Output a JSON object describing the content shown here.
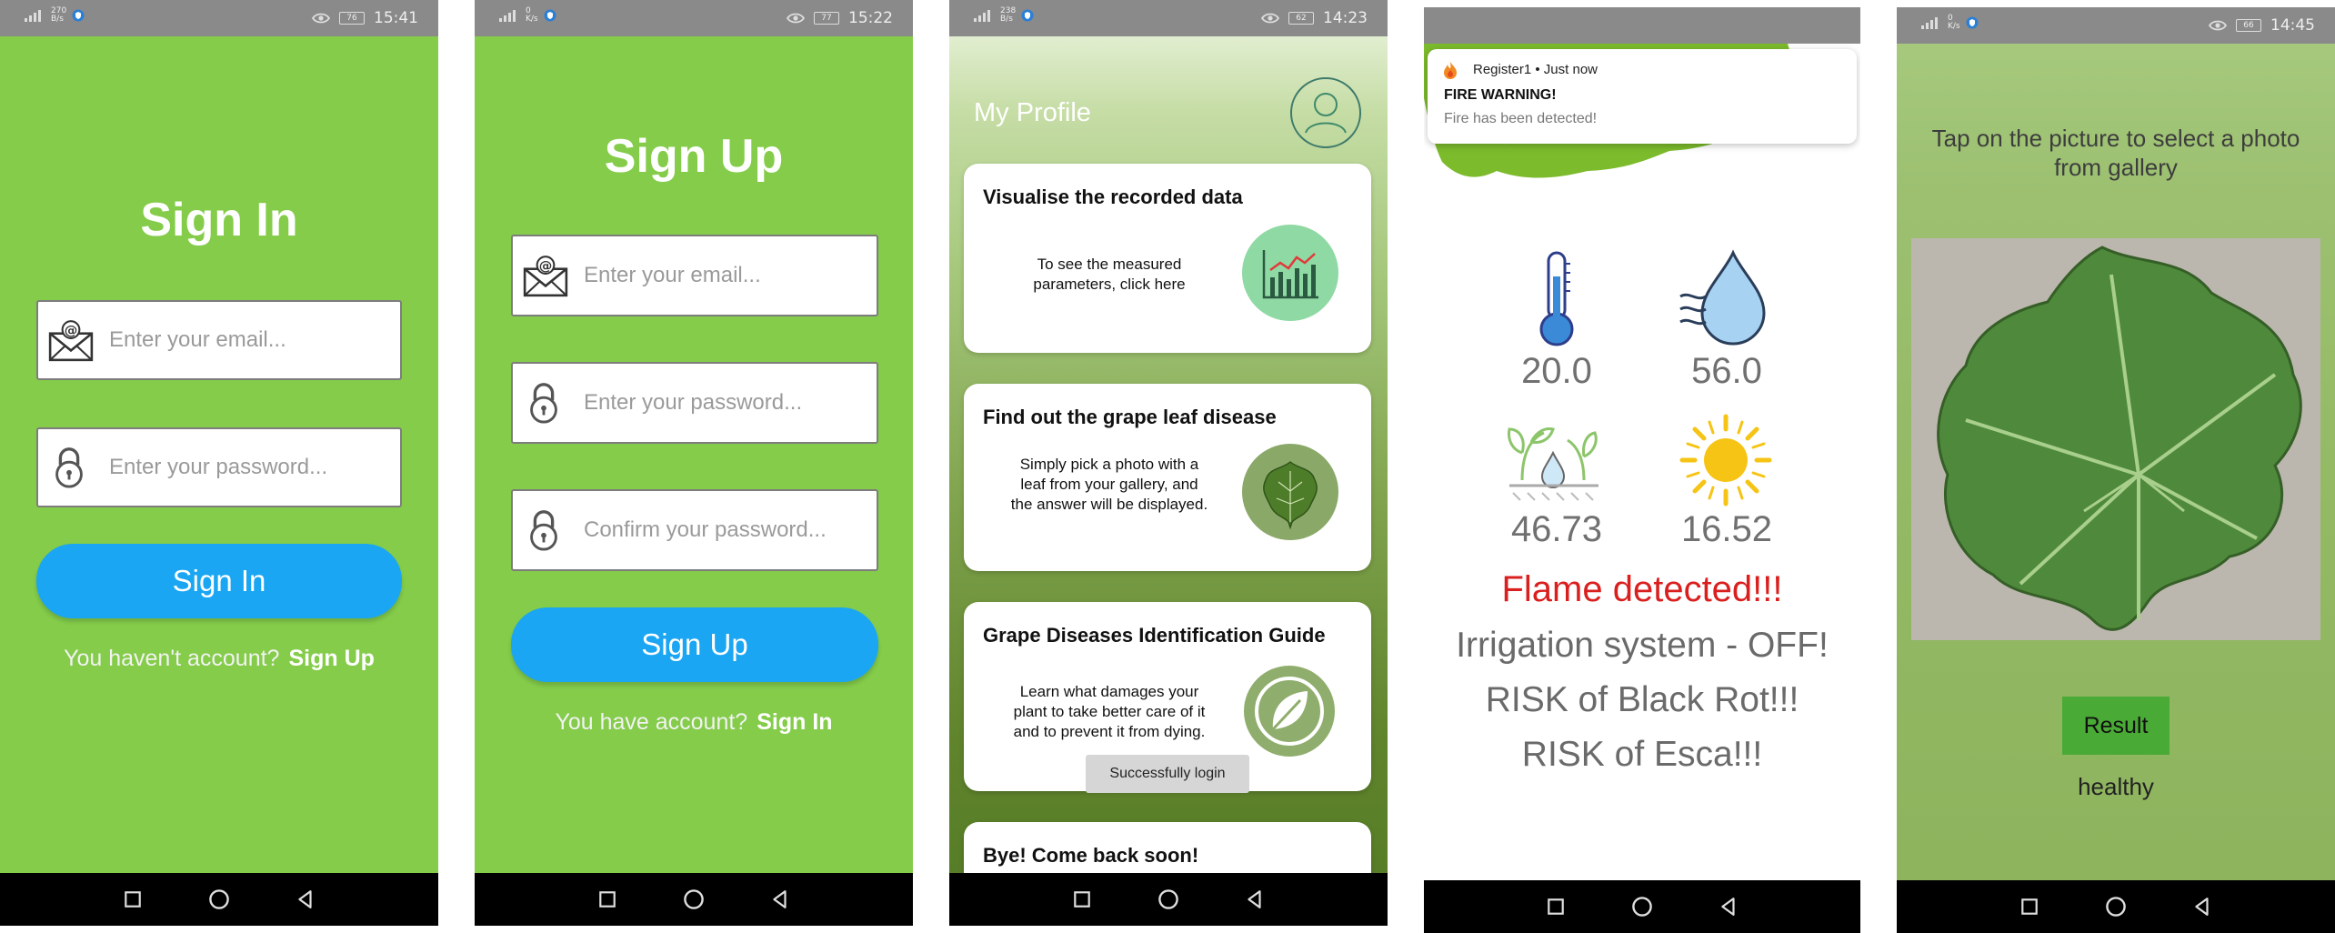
{
  "screens": {
    "signin": {
      "status": {
        "time": "15:41",
        "speed_top": "270",
        "speed_unit": "B/s",
        "net": "4G",
        "battery": "76"
      },
      "title": "Sign In",
      "email_placeholder": "Enter your email...",
      "password_placeholder": "Enter your password...",
      "button": "Sign In",
      "footer_text": "You haven't account?",
      "footer_link": "Sign Up"
    },
    "signup": {
      "status": {
        "time": "15:22",
        "speed_top": "0",
        "speed_unit": "K/s",
        "net": "4G",
        "battery": "77"
      },
      "title": "Sign Up",
      "email_placeholder": "Enter your email...",
      "password_placeholder": "Enter your password...",
      "confirm_placeholder": "Confirm your password...",
      "button": "Sign Up",
      "footer_text": "You have account?",
      "footer_link": "Sign In"
    },
    "profile": {
      "status": {
        "time": "14:23",
        "speed_top": "238",
        "speed_unit": "B/s",
        "net": "4G",
        "battery": "62"
      },
      "title": "My Profile",
      "cards": [
        {
          "title": "Visualise the recorded data",
          "text": "To see the measured parameters, click here"
        },
        {
          "title": "Find out the grape leaf disease",
          "text": "Simply pick a photo with a leaf from your gallery, and the answer will be displayed."
        },
        {
          "title": "Grape Diseases Identification Guide",
          "text": "Learn what damages your plant to take better care of it and to prevent it from dying."
        },
        {
          "title": "Bye! Come back soon!",
          "text": ""
        }
      ],
      "toast": "Successfully login"
    },
    "sensors": {
      "notification": {
        "app": "Register1",
        "when": "Just now",
        "title": "FIRE WARNING!",
        "body": "Fire has been detected!"
      },
      "readings": {
        "temperature": "20.0",
        "humidity": "56.0",
        "soil": "46.73",
        "light": "16.52"
      },
      "alert": "Flame detected!!!",
      "alert_color": "#d9201f",
      "messages": [
        "Irrigation system - OFF!",
        "RISK of Black Rot!!!",
        "RISK of Esca!!!"
      ]
    },
    "leaf": {
      "status": {
        "time": "14:45",
        "speed_top": "0",
        "speed_unit": "K/s",
        "net": "4G",
        "battery": "66"
      },
      "instruction": "Tap on the picture to select a photo from gallery",
      "button": "Result",
      "result": "healthy"
    }
  },
  "icons": [
    "mail-icon",
    "lock-icon",
    "avatar-icon",
    "chart-icon",
    "leaf-icon",
    "guide-leaf-icon",
    "fire-icon",
    "thermometer-icon",
    "water-drop-icon",
    "soil-moisture-icon",
    "sun-icon",
    "square-nav-icon",
    "circle-nav-icon",
    "back-nav-icon",
    "wifi-icon",
    "signal-icon"
  ],
  "colors": {
    "green": "#84cc4a",
    "blue_button": "#1aa6f2",
    "status_bar": "#8a8a8a",
    "result_button": "#4aaa36"
  }
}
